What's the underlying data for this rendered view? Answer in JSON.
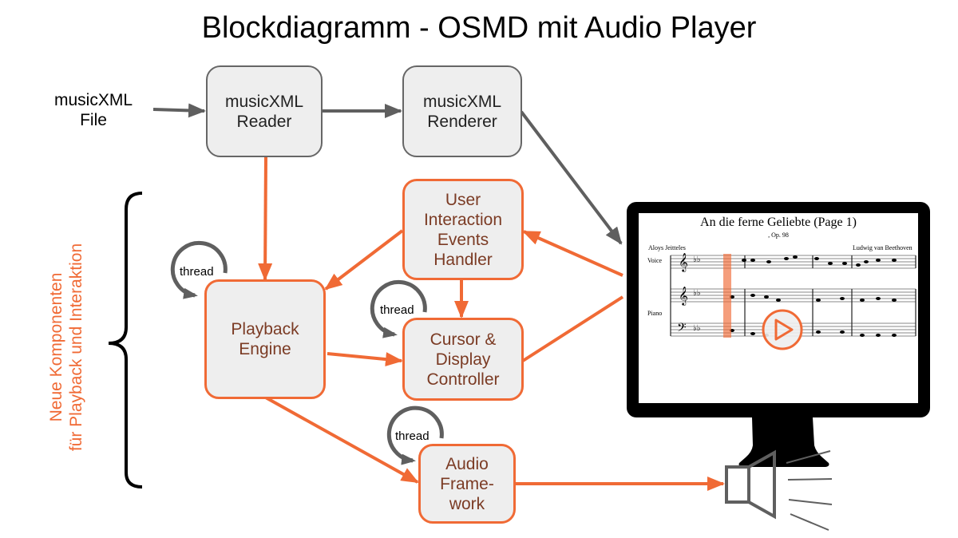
{
  "title": "Blockdiagramm - OSMD mit Audio Player",
  "input_label": "musicXML\nFile",
  "nodes": {
    "reader": "musicXML\nReader",
    "renderer": "musicXML\nRenderer",
    "user_interaction": "User\nInteraction\nEvents\nHandler",
    "playback_engine": "Playback\nEngine",
    "cursor_controller": "Cursor &\nDisplay\nController",
    "audio_framework": "Audio\nFrame-\nwork"
  },
  "thread_label": "thread",
  "side_group_label": "Neue Komponenten\nfür Playback und Interaktion",
  "monitor": {
    "score_title": "An die ferne Geliebte (Page 1)",
    "score_subtitle": ", Op. 98",
    "lyricist": "Aloys Jeitteles",
    "composer": "Ludwig van Beethoven",
    "staff_voice": "Voice",
    "staff_piano": "Piano"
  },
  "colors": {
    "accent": "#f06a35",
    "gray_arrow": "#5f5f5f",
    "node_fill": "#eeeeee",
    "node_text_orange": "#7b3b24"
  }
}
